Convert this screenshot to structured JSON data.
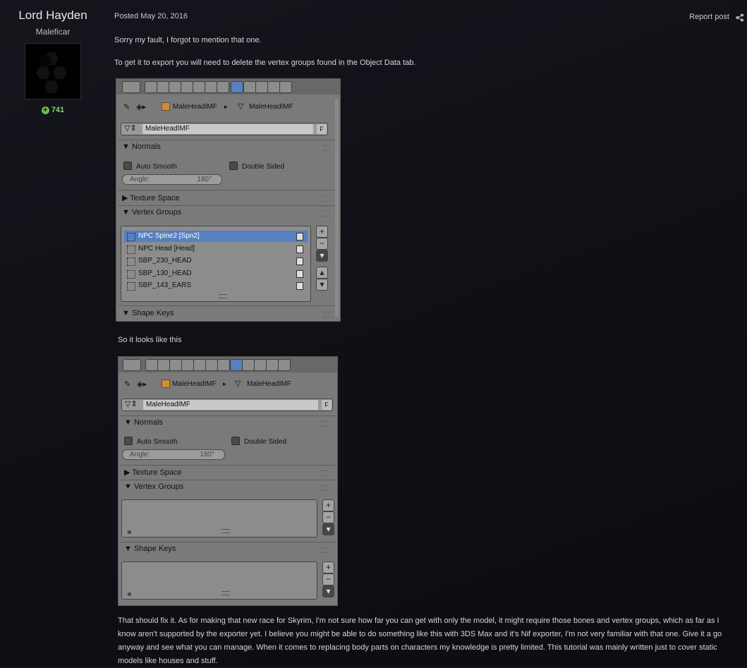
{
  "author": {
    "name": "Lord Hayden",
    "title": "Maleficar",
    "reputation": "741"
  },
  "post": {
    "posted": "Posted May 20, 2016",
    "report": "Report post",
    "para1": "Sorry my fault, I forgot to mention that one.",
    "para2": "To get it to export you will need to delete the vertex groups found in the Object Data tab.",
    "para3": "So it looks like this",
    "para4": "That should fix it. As for making that new race for Skyrim, I'm not sure how far you can get with only the model, it might require those bones and vertex groups, which as far as I know aren't supported by the exporter yet. I believe you might be able to do something like this with 3DS Max and it's Nif exporter, I'm not very familiar with that one. Give it a go anyway and see what you can manage. When it comes to replacing body parts on characters my knowledge is pretty limited. This tutorial was mainly written just to cover static models like houses and stuff."
  },
  "shot1": {
    "crumb1": "MaleHeadIMF",
    "crumb2": "MaleHeadIMF",
    "field": "MaleHeadIMF",
    "fake_btn": "F",
    "normals": "Normals",
    "auto_smooth": "Auto Smooth",
    "double_sided": "Double Sided",
    "angle_label": "Angle:",
    "angle_value": "180°",
    "texture_space": "Texture Space",
    "vertex_groups": "Vertex Groups",
    "groups": [
      "NPC Spine2 [Spn2]",
      "NPC Head [Head]",
      "SBP_230_HEAD",
      "SBP_130_HEAD",
      "SBP_143_EARS"
    ],
    "shape_keys": "Shape Keys"
  },
  "shot2": {
    "crumb1": "MaleHeadIMF",
    "crumb2": "MaleHeadIMF",
    "field": "MaleHeadIMF",
    "fake_btn": "F",
    "normals": "Normals",
    "auto_smooth": "Auto Smooth",
    "double_sided": "Double Sided",
    "angle_label": "Angle:",
    "angle_value": "180°",
    "texture_space": "Texture Space",
    "vertex_groups": "Vertex Groups",
    "shape_keys": "Shape Keys"
  },
  "colors": {
    "selected": "#5680c2",
    "reputation": "#8fcf6c",
    "panel": "#7a7a7a"
  }
}
